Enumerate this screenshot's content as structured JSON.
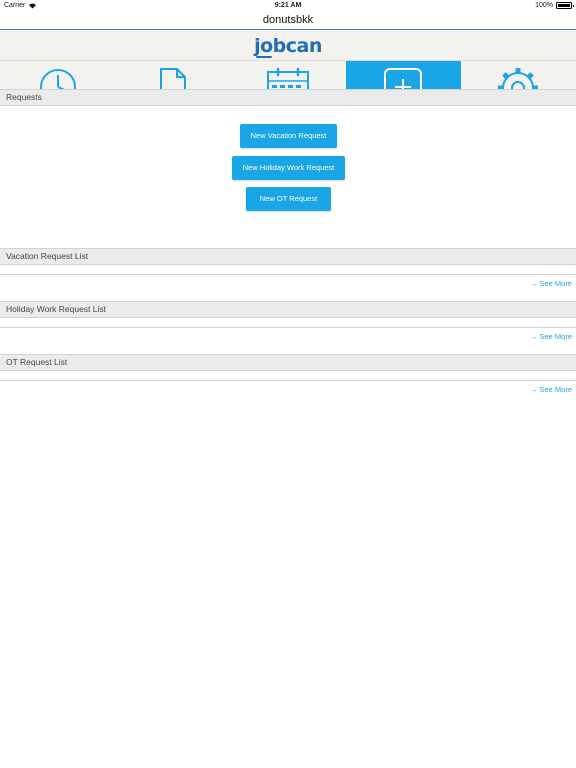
{
  "status_bar": {
    "carrier": "Carrier",
    "time": "9:21 AM",
    "battery": "100%"
  },
  "nav": {
    "title": "donutsbkk"
  },
  "brand": {
    "logo_text": "jobcan"
  },
  "tabs": [
    {
      "icon": "clock-icon",
      "active": false
    },
    {
      "icon": "document-icon",
      "active": false
    },
    {
      "icon": "calendar-icon",
      "active": false
    },
    {
      "icon": "plus-square-icon",
      "active": true
    },
    {
      "icon": "gear-icon",
      "active": false
    }
  ],
  "requests": {
    "header": "Requests",
    "buttons": {
      "vacation": "New Vacation Request",
      "holiday_work": "New Holiday Work Request",
      "ot": "New OT Request"
    }
  },
  "lists": {
    "vacation": {
      "header": "Vacation Request List",
      "see_more": "→ See More"
    },
    "holiday_work": {
      "header": "Holiday Work Request List",
      "see_more": "→ See More"
    },
    "ot": {
      "header": "OT Request List",
      "see_more": "→ See More"
    }
  },
  "colors": {
    "accent": "#1aa6e6",
    "brand": "#1e6fb7",
    "nav_underline": "#3c7ad6"
  }
}
